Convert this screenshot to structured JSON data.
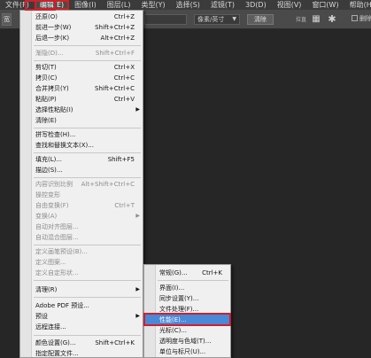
{
  "menubar": {
    "items": [
      {
        "label": "文件(F)"
      },
      {
        "label": "编辑(E)"
      },
      {
        "label": "图像(I)"
      },
      {
        "label": "图层(L)"
      },
      {
        "label": "类型(Y)"
      },
      {
        "label": "选择(S)"
      },
      {
        "label": "滤镜(T)"
      },
      {
        "label": "3D(D)"
      },
      {
        "label": "视图(V)"
      },
      {
        "label": "窗口(W)"
      },
      {
        "label": "帮助(H)"
      }
    ]
  },
  "optionsbar": {
    "left_tool": "宽",
    "unit": "像素/英寸",
    "clear_btn": "清除",
    "straighten": "拉直",
    "right_check": "删除"
  },
  "edit_menu": {
    "items": [
      {
        "label": "还原(O)",
        "shortcut": "Ctrl+Z"
      },
      {
        "label": "前进一步(W)",
        "shortcut": "Shift+Ctrl+Z"
      },
      {
        "label": "后退一步(K)",
        "shortcut": "Alt+Ctrl+Z"
      },
      {
        "label": "渐隐(D)...",
        "shortcut": "Shift+Ctrl+F"
      },
      {
        "label": "剪切(T)",
        "shortcut": "Ctrl+X"
      },
      {
        "label": "拷贝(C)",
        "shortcut": "Ctrl+C"
      },
      {
        "label": "合并拷贝(Y)",
        "shortcut": "Shift+Ctrl+C"
      },
      {
        "label": "粘贴(P)",
        "shortcut": "Ctrl+V"
      },
      {
        "label": "选择性粘贴(I)",
        "shortcut": ""
      },
      {
        "label": "清除(E)",
        "shortcut": ""
      },
      {
        "label": "拼写检查(H)...",
        "shortcut": ""
      },
      {
        "label": "查找和替换文本(X)...",
        "shortcut": ""
      },
      {
        "label": "填充(L)...",
        "shortcut": "Shift+F5"
      },
      {
        "label": "描边(S)...",
        "shortcut": ""
      },
      {
        "label": "内容识别比例",
        "shortcut": "Alt+Shift+Ctrl+C"
      },
      {
        "label": "操控变形",
        "shortcut": ""
      },
      {
        "label": "自由变换(F)",
        "shortcut": "Ctrl+T"
      },
      {
        "label": "变换(A)",
        "shortcut": ""
      },
      {
        "label": "自动对齐图层...",
        "shortcut": ""
      },
      {
        "label": "自动混合图层...",
        "shortcut": ""
      },
      {
        "label": "定义画笔预设(B)...",
        "shortcut": ""
      },
      {
        "label": "定义图案...",
        "shortcut": ""
      },
      {
        "label": "定义自定形状...",
        "shortcut": ""
      },
      {
        "label": "清理(R)",
        "shortcut": ""
      },
      {
        "label": "Adobe PDF 预设...",
        "shortcut": ""
      },
      {
        "label": "预设",
        "shortcut": ""
      },
      {
        "label": "远程连接...",
        "shortcut": ""
      },
      {
        "label": "颜色设置(G)...",
        "shortcut": "Shift+Ctrl+K"
      },
      {
        "label": "指定配置文件...",
        "shortcut": ""
      }
    ]
  },
  "preferences_menu": {
    "items": [
      {
        "label": "常规(G)...",
        "shortcut": "Ctrl+K"
      },
      {
        "label": "界面(I)...",
        "shortcut": ""
      },
      {
        "label": "同步设置(Y)...",
        "shortcut": ""
      },
      {
        "label": "文件处理(F)...",
        "shortcut": ""
      },
      {
        "label": "性能(E)...",
        "shortcut": ""
      },
      {
        "label": "光标(C)...",
        "shortcut": ""
      },
      {
        "label": "透明度与色域(T)...",
        "shortcut": ""
      },
      {
        "label": "单位与标尺(U)...",
        "shortcut": ""
      }
    ]
  },
  "colors": {
    "highlight": "#4a88d8",
    "annotation_red": "#d0202a"
  }
}
